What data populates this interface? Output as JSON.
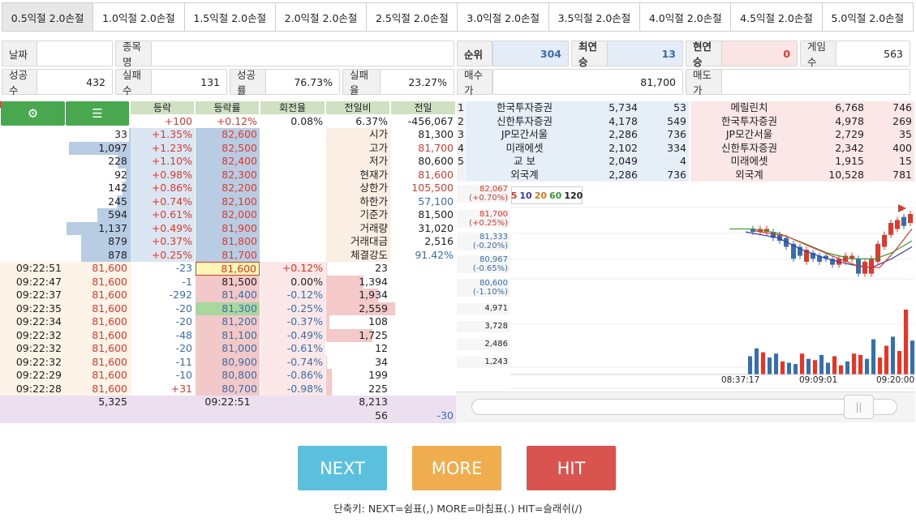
{
  "tabs": [
    "0.5익절 2.0손절",
    "1.0익절 2.0손절",
    "1.5익절 2.0손절",
    "2.0익절 2.0손절",
    "2.5익절 2.0손절",
    "3.0익절 2.0손절",
    "3.5익절 2.0손절",
    "4.0익절 2.0손절",
    "4.5익절 2.0손절",
    "5.0익절 2.0손절"
  ],
  "info": {
    "date_label": "날짜",
    "date_value": "",
    "stock_label": "종목명",
    "stock_value": "",
    "rank_label": "순위",
    "rank_value": "304",
    "win_streak_label": "최연승",
    "win_streak_value": "13",
    "cur_streak_label": "현연승",
    "cur_streak_value": "0",
    "games_label": "게임수",
    "games_value": "563",
    "success_label": "성공수",
    "success_value": "432",
    "fail_label": "실패수",
    "fail_value": "131",
    "success_rate_label": "성공률",
    "success_rate_value": "76.73%",
    "fail_rate_label": "실패율",
    "fail_rate_value": "23.27%",
    "buy_label": "매수가",
    "buy_value": "81,700",
    "sell_label": "매도가",
    "sell_value": ""
  },
  "book": {
    "headers": [
      "등락",
      "등락률",
      "회전율",
      "전일비",
      "전일"
    ],
    "head_values": [
      "+100",
      "+0.12%",
      "0.08%",
      "6.37%",
      "-456,067"
    ],
    "asks": [
      [
        "33",
        "+1.35%",
        "82,600"
      ],
      [
        "1,097",
        "+1.23%",
        "82,500"
      ],
      [
        "228",
        "+1.10%",
        "82,400"
      ],
      [
        "92",
        "+0.98%",
        "82,300"
      ],
      [
        "142",
        "+0.86%",
        "82,200"
      ],
      [
        "245",
        "+0.74%",
        "82,100"
      ],
      [
        "594",
        "+0.61%",
        "82,000"
      ],
      [
        "1,137",
        "+0.49%",
        "81,900"
      ],
      [
        "879",
        "+0.37%",
        "81,800"
      ],
      [
        "878",
        "+0.25%",
        "81,700"
      ]
    ],
    "stats": [
      [
        "시가",
        "81,300"
      ],
      [
        "고가",
        "81,700"
      ],
      [
        "저가",
        "80,600"
      ],
      [
        "현재가",
        "81,600"
      ],
      [
        "상한가",
        "105,500"
      ],
      [
        "하한가",
        "57,100"
      ],
      [
        "기준가",
        "81,500"
      ],
      [
        "거래량",
        "31,020"
      ],
      [
        "거래대금",
        "2,516"
      ],
      [
        "체결강도",
        "91.42%"
      ]
    ],
    "trades": [
      [
        "09:22:51",
        "81,600",
        "-23"
      ],
      [
        "09:22:47",
        "81,600",
        "-1"
      ],
      [
        "09:22:37",
        "81,600",
        "-292"
      ],
      [
        "09:22:35",
        "81,600",
        "-20"
      ],
      [
        "09:22:34",
        "81,600",
        "-20"
      ],
      [
        "09:22:32",
        "81,600",
        "-48"
      ],
      [
        "09:22:32",
        "81,600",
        "-20"
      ],
      [
        "09:22:32",
        "81,600",
        "-11"
      ],
      [
        "09:22:29",
        "81,600",
        "-10"
      ],
      [
        "09:22:28",
        "81,600",
        "+31"
      ]
    ],
    "bids": [
      [
        "81,600",
        "+0.12%",
        "23"
      ],
      [
        "81,500",
        "0.00%",
        "1,394"
      ],
      [
        "81,400",
        "-0.12%",
        "1,934"
      ],
      [
        "81,300",
        "-0.25%",
        "2,559"
      ],
      [
        "81,200",
        "-0.37%",
        "108"
      ],
      [
        "81,100",
        "-0.49%",
        "1,725"
      ],
      [
        "81,000",
        "-0.61%",
        "12"
      ],
      [
        "80,900",
        "-0.74%",
        "34"
      ],
      [
        "80,800",
        "-0.86%",
        "199"
      ],
      [
        "80,700",
        "-0.98%",
        "225"
      ]
    ],
    "sum_ask": "5,325",
    "sum_time": "09:22:51",
    "sum_bid": "8,213",
    "last_a": "56",
    "last_b": "-30"
  },
  "brokers": [
    [
      "1",
      "한국투자증권",
      "5,734",
      "53",
      "메릴린치",
      "6,768",
      "746"
    ],
    [
      "2",
      "신한투자증권",
      "4,178",
      "549",
      "한국투자증권",
      "4,978",
      "269"
    ],
    [
      "3",
      "JP모간서울",
      "2,286",
      "736",
      "JP모간서울",
      "2,729",
      "35"
    ],
    [
      "4",
      "미래에셋",
      "2,102",
      "334",
      "신한투자증권",
      "2,342",
      "400"
    ],
    [
      "5",
      "교 보",
      "2,049",
      "4",
      "미래에셋",
      "1,915",
      "15"
    ],
    [
      "",
      "외국계",
      "2,286",
      "736",
      "외국계",
      "10,528",
      "781"
    ]
  ],
  "chart": {
    "price_axis": [
      [
        "82,067",
        "(+0.70%)"
      ],
      [
        "81,700",
        "(+0.25%)"
      ],
      [
        "81,333",
        "(-0.20%)"
      ],
      [
        "80,967",
        "(-0.65%)"
      ],
      [
        "80,600",
        "(-1.10%)"
      ]
    ],
    "vol_axis": [
      "4,971",
      "3,728",
      "2,486",
      "1,243"
    ],
    "ma_legend": [
      "5",
      "10",
      "20",
      "60",
      "120"
    ],
    "time_axis": [
      "08:37:17",
      "09:09:01",
      "09:20:00"
    ]
  },
  "buttons": {
    "next": "NEXT",
    "more": "MORE",
    "hit": "HIT"
  },
  "footer": "단축키: NEXT=쉼표(,) MORE=마침표(.) HIT=슬래쉬(/)"
}
